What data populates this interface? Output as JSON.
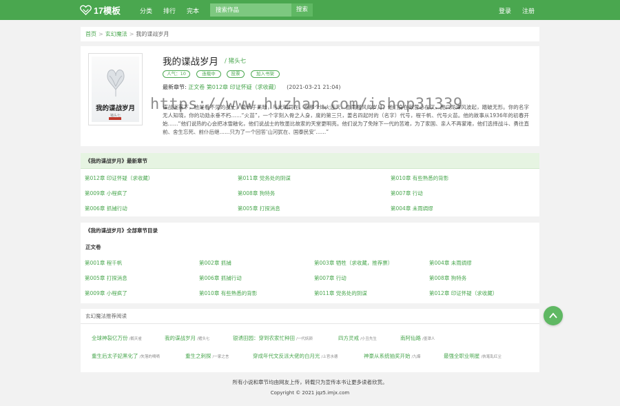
{
  "header": {
    "logo_text": "17模板",
    "nav": [
      "分类",
      "排行",
      "完本"
    ],
    "search_placeholder": "搜索作品",
    "search_button": "搜索",
    "login": "登录",
    "register": "注册"
  },
  "breadcrumb": {
    "home": "首页",
    "category": "玄幻魔法",
    "current": "我的谍战岁月",
    "separator": ">"
  },
  "book": {
    "cover_title": "我的谍战岁月",
    "cover_author": "猪头七",
    "title": "我的谍战岁月",
    "author": "/ 猪头七",
    "badges": [
      "人气：10",
      "连载中",
      "投票",
      "加入书架"
    ],
    "latest_label": "最新章节:",
    "latest_chapter": "正文卷 第012章 印证怀疑（求收藏）",
    "latest_time": "(2021-03-21 21:04)",
    "intro": "谍战迷雾下，他是看不见的战士。蛰伏于黑暗，与光明同在。在那个烽火连天、血雨腥风的岁月，他们身在敌营心在汉，虎穴龙潭风波起，踏破无形。你的名字无人知晓，你的功勋永垂不朽……“火苗”，一个字刻入骨之人身，度的第三只，姜名四起时的（名字）代号，程千帆、代号火苗。他的故事从1936年的初春开始……“他们说热的心会把冰雪融化，他们说战士的牧墨比故家的天堂更明亮。他们说为了免除下一代的苦难，为了家国、亲人不再蒙难，他们选择战斗、勇往直前、舍生忘死、前仆后继……只为了一个回答‘山河犹在、国泰民安’……”"
  },
  "newest": {
    "heading": "《我的谍战岁月》最新章节",
    "chapters": [
      "第012章 印证怀疑（求收藏）",
      "第011章 党务处的阴谋",
      "第010章 有些熟悉的背影",
      "第009章 小程疯了",
      "第008章 狗特务",
      "第007章 行动",
      "第006章 抓捕行动",
      "第005章 打探消息",
      "第004章 未雨绸缪"
    ]
  },
  "catalog": {
    "heading": "《我的谍战岁月》全部章节目录",
    "volume": "正文卷",
    "chapters": [
      "第001章 程千帆",
      "第002章 抓捕",
      "第003章 牺牲（求收藏，推荐票）",
      "第004章 未雨绸缪",
      "第005章 打探消息",
      "第006章 抓捕行动",
      "第007章 行动",
      "第008章 狗特务",
      "第009章 小程疯了",
      "第010章 有些熟悉的背影",
      "第011章 党务处的阴谋",
      "第012章 印证怀疑（求收藏）"
    ]
  },
  "recommend": {
    "heading": "玄幻魔法推荐阅读",
    "row1": [
      {
        "title": "全球神裂亿万份",
        "author": "/鹅天雀"
      },
      {
        "title": "我的谍战岁月",
        "author": "/猪头七"
      },
      {
        "title": "银诱田园：穿到农家忙种田",
        "author": "/一代妖颜"
      },
      {
        "title": "四方灵戒",
        "author": "/小丑先生"
      },
      {
        "title": "南阿仙路",
        "author": "/墨潭人"
      }
    ],
    "row2": [
      {
        "title": "重生后太子妃黑化了",
        "author": "/失落的嘀嘀"
      },
      {
        "title": "重生之刺探",
        "author": "/一家之言"
      },
      {
        "title": "穿成年代文反派大佬的白月光",
        "author": "/上官水德"
      },
      {
        "title": "神豪从系统抽奖开始",
        "author": "/九爆"
      },
      {
        "title": "最强全职业明星",
        "author": "/执笔乱红尘"
      }
    ]
  },
  "footer": {
    "line1": "所有小说和章节均由网友上传，转载只为宣传本书让更多读者欣赏。",
    "line2": "Copyright © 2021 jqz5.imjx.com"
  },
  "watermark": "https://www.huzhan.com/ishop31339",
  "colors": {
    "accent": "#4aa74f",
    "light_green_header": "#e6f4e2",
    "background": "#f2f2f2"
  }
}
